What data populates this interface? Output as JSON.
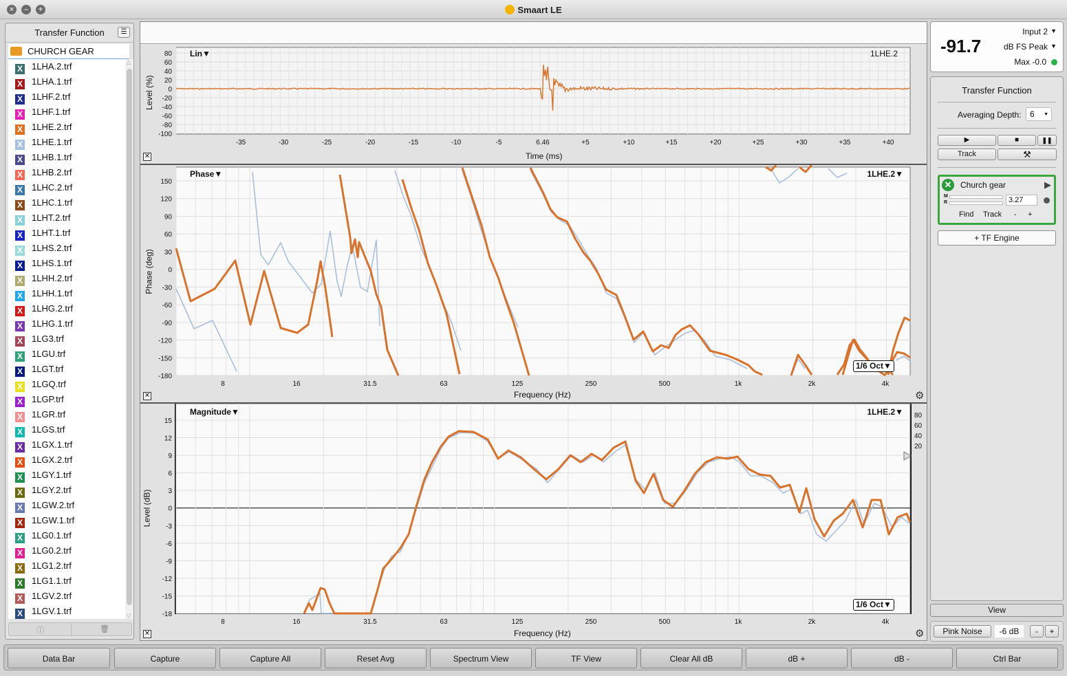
{
  "window": {
    "title": "Smaart LE"
  },
  "sidebar": {
    "header": "Transfer Function",
    "folder": "CHURCH GEAR",
    "files": [
      {
        "name": "1LHA.2.trf",
        "color": "#3b6e6e"
      },
      {
        "name": "1LHA.1.trf",
        "color": "#a11b1b"
      },
      {
        "name": "1LHF.2.trf",
        "color": "#1d2f8a"
      },
      {
        "name": "1LHF.1.trf",
        "color": "#e41fb5"
      },
      {
        "name": "1LHE.2.trf",
        "color": "#e07020"
      },
      {
        "name": "1LHE.1.trf",
        "color": "#a8c0e0"
      },
      {
        "name": "1LHB.1.trf",
        "color": "#4a4a8a"
      },
      {
        "name": "1LHB.2.trf",
        "color": "#f06a5a"
      },
      {
        "name": "1LHC.2.trf",
        "color": "#3a78a8"
      },
      {
        "name": "1LHC.1.trf",
        "color": "#8a4a1a"
      },
      {
        "name": "1LHT.2.trf",
        "color": "#8ad0d8"
      },
      {
        "name": "1LHT.1.trf",
        "color": "#1a24c0"
      },
      {
        "name": "1LHS.2.trf",
        "color": "#9adcdc"
      },
      {
        "name": "1LHS.1.trf",
        "color": "#0a1a90"
      },
      {
        "name": "1LHH.2.trf",
        "color": "#b0a870"
      },
      {
        "name": "1LHH.1.trf",
        "color": "#20a8e8"
      },
      {
        "name": "1LHG.2.trf",
        "color": "#d01818"
      },
      {
        "name": "1LHG.1.trf",
        "color": "#7a38b0"
      },
      {
        "name": "1LG3.trf",
        "color": "#a04858"
      },
      {
        "name": "1LGU.trf",
        "color": "#30a078"
      },
      {
        "name": "1LGT.trf",
        "color": "#0a1a7a"
      },
      {
        "name": "1LGQ.trf",
        "color": "#e8e020"
      },
      {
        "name": "1LGP.trf",
        "color": "#9a20c8"
      },
      {
        "name": "1LGR.trf",
        "color": "#f09090"
      },
      {
        "name": "1LGS.trf",
        "color": "#10b8b0"
      },
      {
        "name": "1LGX.1.trf",
        "color": "#6a2aa0"
      },
      {
        "name": "1LGX.2.trf",
        "color": "#e05010"
      },
      {
        "name": "1LGY.1.trf",
        "color": "#209050"
      },
      {
        "name": "1LGY.2.trf",
        "color": "#6a6a10"
      },
      {
        "name": "1LGW.2.trf",
        "color": "#6a7ab0"
      },
      {
        "name": "1LGW.1.trf",
        "color": "#a02a10"
      },
      {
        "name": "1LG0.1.trf",
        "color": "#2aa080"
      },
      {
        "name": "1LG0.2.trf",
        "color": "#e02090"
      },
      {
        "name": "1LG1.2.trf",
        "color": "#8a6a10"
      },
      {
        "name": "1LG1.1.trf",
        "color": "#2a7a2a"
      },
      {
        "name": "1LGV.2.trf",
        "color": "#b05a5a"
      },
      {
        "name": "1LGV.1.trf",
        "color": "#2a4a7a"
      }
    ]
  },
  "impulse": {
    "label": "Lin▼",
    "trace": "1LHE.2",
    "ylabel": "Level (%)",
    "xlabel": "Time (ms)",
    "yticks": [
      "80",
      "60",
      "40",
      "20",
      "0",
      "-20",
      "-40",
      "-60",
      "-80",
      "-100"
    ],
    "xticks": [
      "-35",
      "-30",
      "-25",
      "-20",
      "-15",
      "-10",
      "-5",
      "6.46",
      "+5",
      "+10",
      "+15",
      "+20",
      "+25",
      "+30",
      "+35",
      "+40"
    ]
  },
  "phase": {
    "label": "Phase▼",
    "trace": "1LHE.2▼",
    "ylabel": "Phase (deg)",
    "xlabel": "Frequency (Hz)",
    "yticks": [
      "150",
      "120",
      "90",
      "60",
      "30",
      "0",
      "-30",
      "-60",
      "-90",
      "-120",
      "-150",
      "-180"
    ],
    "xticks": [
      "8",
      "16",
      "31.5",
      "63",
      "125",
      "250",
      "500",
      "1k",
      "2k",
      "4k"
    ],
    "smoothing": "1/6 Oct▼"
  },
  "magnitude": {
    "label": "Magnitude▼",
    "trace": "1LHE.2▼",
    "ylabel": "Level (dB)",
    "xlabel": "Frequency (Hz)",
    "yticks": [
      "15",
      "12",
      "9",
      "6",
      "3",
      "0",
      "-3",
      "-6",
      "-9",
      "-12",
      "-15",
      "-18"
    ],
    "xticks": [
      "8",
      "16",
      "31.5",
      "63",
      "125",
      "250",
      "500",
      "1k",
      "2k",
      "4k"
    ],
    "coherence_ticks": [
      "80",
      "60",
      "40",
      "20"
    ],
    "smoothing": "1/6 Oct▼"
  },
  "meter": {
    "value": "-91.7",
    "input": "Input 2",
    "mode": "dB FS Peak",
    "max": "Max -0.0"
  },
  "tf": {
    "title": "Transfer Function",
    "avg_label": "Averaging Depth:",
    "avg_value": "6",
    "track": "Track",
    "engine_name": "Church gear",
    "delay": "3.27",
    "find": "Find",
    "track2": "Track",
    "minus": "-",
    "plus": "+",
    "add_engine": "+ TF Engine"
  },
  "view": {
    "label": "View",
    "pink": "Pink Noise",
    "level": "-6 dB",
    "minus": "-",
    "plus": "+"
  },
  "bottom": [
    "Data Bar",
    "Capture",
    "Capture All",
    "Reset Avg",
    "Spectrum View",
    "TF View",
    "Clear All dB",
    "dB +",
    "dB -",
    "Ctrl Bar"
  ],
  "colors": {
    "primary": "#d9722a",
    "reference": "#a9bfdc"
  }
}
